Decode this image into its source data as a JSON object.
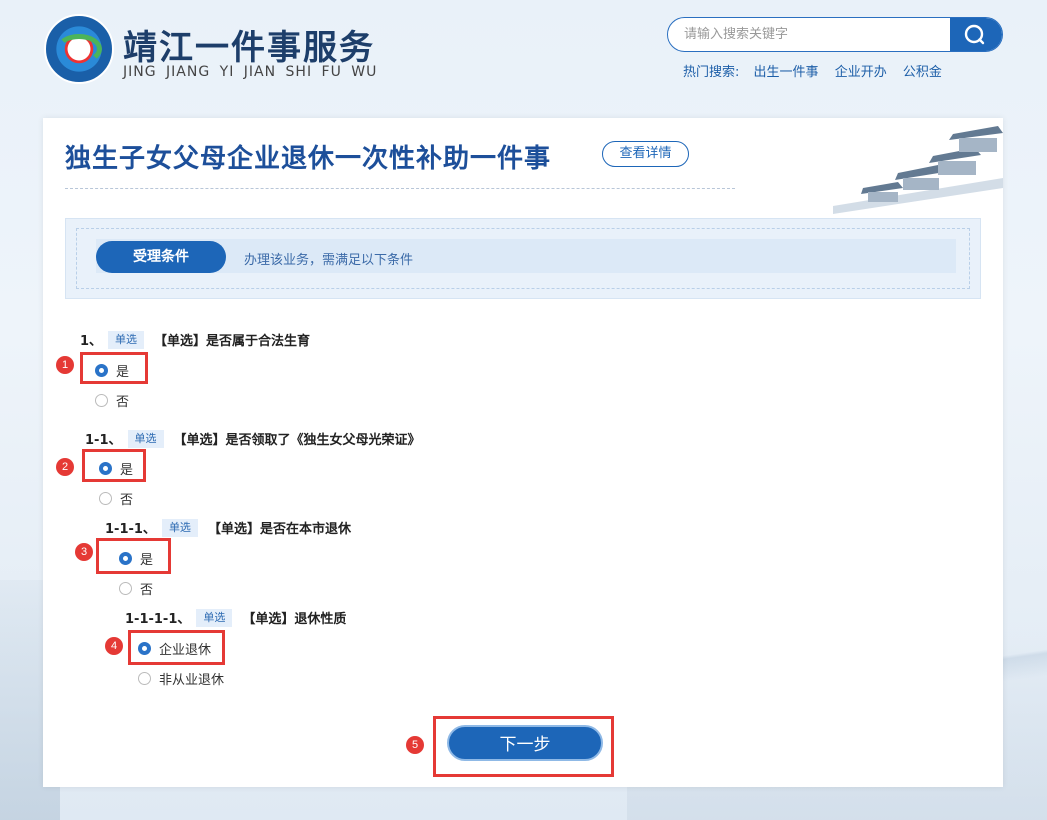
{
  "header": {
    "logo_title": "靖江一件事服务",
    "logo_subtitle": "JING JIANG YI JIAN SHI FU WU",
    "search_placeholder": "请输入搜索关键字",
    "hot_label": "热门搜索:",
    "hot_items": [
      "出生一件事",
      "企业开办",
      "公积金"
    ]
  },
  "page": {
    "title": "独生子女父母企业退休一次性补助一件事",
    "detail_button": "查看详情",
    "condition_tag": "受理条件",
    "condition_text": "办理该业务，需满足以下条件"
  },
  "questions": [
    {
      "num": "1、",
      "badge": "单选",
      "text": "【单选】是否属于合法生育",
      "options": [
        "是",
        "否"
      ],
      "selected": 0
    },
    {
      "num": "1-1、",
      "badge": "单选",
      "text": "【单选】是否领取了《独生女父母光荣证》",
      "options": [
        "是",
        "否"
      ],
      "selected": 0
    },
    {
      "num": "1-1-1、",
      "badge": "单选",
      "text": "【单选】是否在本市退休",
      "options": [
        "是",
        "否"
      ],
      "selected": 0
    },
    {
      "num": "1-1-1-1、",
      "badge": "单选",
      "text": "【单选】退休性质",
      "options": [
        "企业退休",
        "非从业退休"
      ],
      "selected": 0
    }
  ],
  "markers": [
    "1",
    "2",
    "3",
    "4",
    "5"
  ],
  "next_button": "下一步",
  "colors": {
    "primary": "#1d66b8",
    "marker": "#e53935"
  }
}
